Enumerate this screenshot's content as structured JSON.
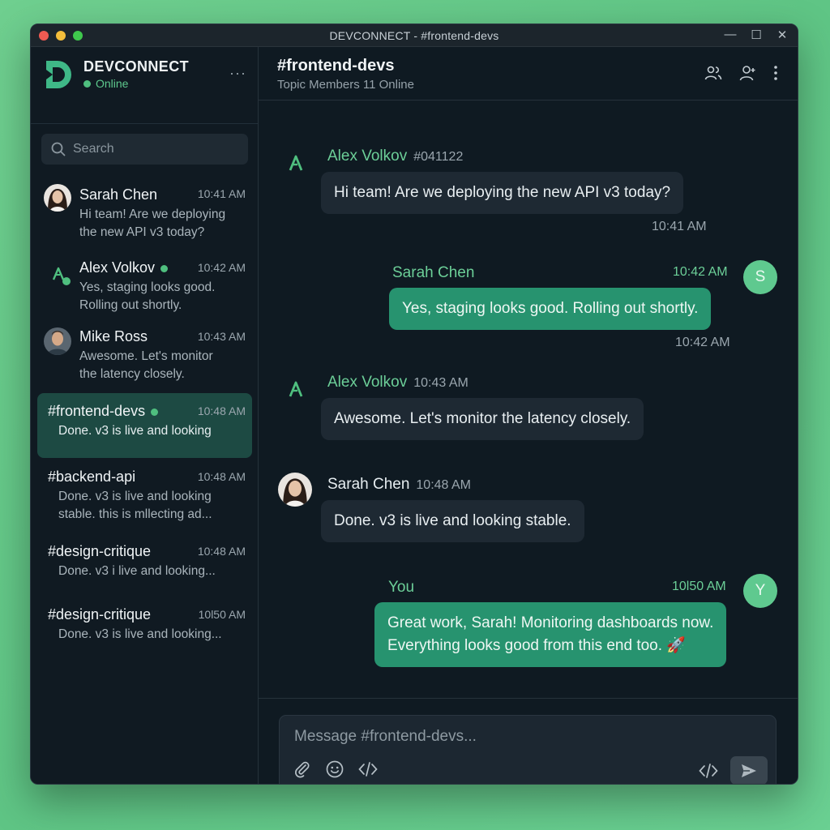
{
  "window": {
    "title": "DEVCONNECT - #frontend-devs",
    "controls": {
      "minimize": "—",
      "maximize": "☐",
      "close": "✕"
    }
  },
  "brand": {
    "name": "DEVCONNECT",
    "status": "Online",
    "more": "···"
  },
  "search": {
    "placeholder": "Search"
  },
  "conversations": [
    {
      "name": "Sarah Chen",
      "time": "10:41 AM",
      "preview_line1": "Hi team! Are we deploying",
      "preview_line2": "the new API v3 today?"
    },
    {
      "name": "Alex Volkov",
      "time": "10:42 AM",
      "preview_line1": "Yes, staging looks good.",
      "preview_line2": "Rolling out shortly.",
      "online": true
    },
    {
      "name": "Mike Ross",
      "time": "10:43 AM",
      "preview_line1": "Awesome. Let's monitor",
      "preview_line2": "the latency closely."
    },
    {
      "name": "#frontend-devs",
      "time": "10:48 AM",
      "preview_line1": "Done. v3 is live and looking",
      "active": true,
      "online": true
    },
    {
      "name": "#backend-api",
      "time": "10:48 AM",
      "preview_line1": "Done. v3 is live and looking",
      "preview_line2": "stable.  this is mllecting ad..."
    },
    {
      "name": "#design-critique",
      "time": "10:48 AM",
      "preview_line1": "Done. v3 i live and looking..."
    },
    {
      "name": "#design-critique",
      "time": "10l50 AM",
      "preview_line1": "Done. v3 is live and looking..."
    }
  ],
  "channel": {
    "name": "#frontend-devs",
    "subtitle": "Topic Members 11 Online"
  },
  "messages": [
    {
      "author": "Alex Volkov",
      "meta": "#041122",
      "text": "Hi team! Are we deploying the new API v3 today?",
      "time": "10:41 AM"
    },
    {
      "author": "Sarah Chen",
      "meta": "10:42 AM",
      "text": "Yes, staging looks good. Rolling out shortly.",
      "time": "10:42 AM",
      "avatar_letter": "S"
    },
    {
      "author": "Alex Volkov",
      "meta": "10:43 AM",
      "text": "Awesome. Let's monitor the latency closely."
    },
    {
      "author": "Sarah Chen",
      "meta": "10:48 AM",
      "text": "Done. v3 is live and looking stable."
    },
    {
      "author": "You",
      "meta": "10l50 AM",
      "text_line1": "Great work, Sarah! Monitoring dashboards now.",
      "text_line2": "Everything looks good from this end too. 🚀",
      "avatar_letter": "Y"
    }
  ],
  "composer": {
    "placeholder": "Message #frontend-devs..."
  },
  "colors": {
    "accent": "#27936f",
    "online": "#4fbf7f",
    "name_green": "#6ccf98",
    "background": "#0f1a22"
  },
  "icons": [
    "search-icon",
    "ellipsis-icon",
    "members-icon",
    "user-icon",
    "kebab-icon",
    "paperclip-icon",
    "emoji-icon",
    "code-icon",
    "send-icon"
  ]
}
